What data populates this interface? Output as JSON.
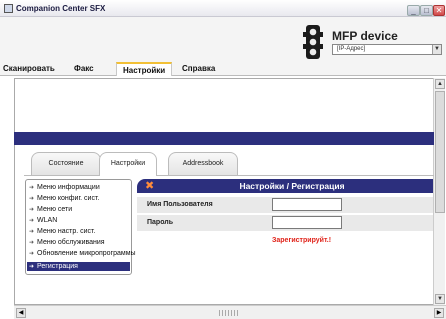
{
  "window": {
    "title": "Companion Center SFX",
    "controls": {
      "minimize": "_",
      "maximize": "□",
      "close": "✕"
    }
  },
  "header": {
    "device_name": "MFP device",
    "ip_select_value": "[IP-Адрес]"
  },
  "menu": {
    "tabs": [
      {
        "label": "Сканировать"
      },
      {
        "label": "Факс"
      },
      {
        "label": "Настройки"
      },
      {
        "label": "Справка"
      }
    ],
    "active": "Настройки"
  },
  "subtabs": {
    "items": [
      {
        "label": "Состояние"
      },
      {
        "label": "Настройки"
      },
      {
        "label": "Addressbook"
      }
    ],
    "active": "Настройки"
  },
  "sidebar": {
    "items": [
      {
        "label": "Меню информации"
      },
      {
        "label": "Меню конфиг. сист."
      },
      {
        "label": "Меню сети"
      },
      {
        "label": "WLAN"
      },
      {
        "label": "Меню настр. сист."
      },
      {
        "label": "Меню обслуживания"
      },
      {
        "label": "Обновление микропрограммы"
      },
      {
        "label": "Регистрация"
      }
    ],
    "active": "Регистрация"
  },
  "panel": {
    "title": "Настройки / Регистрация",
    "icon": "tools-icon",
    "fields": [
      {
        "label": "Имя Пользователя",
        "value": ""
      },
      {
        "label": "Пароль",
        "value": ""
      }
    ],
    "register_label": "Зарегистрируйт.!"
  },
  "colors": {
    "navy": "#2c2f7d",
    "accent_orange": "#ff8c3a",
    "register_red": "#e0231a",
    "active_tab_border": "#f2c036"
  }
}
